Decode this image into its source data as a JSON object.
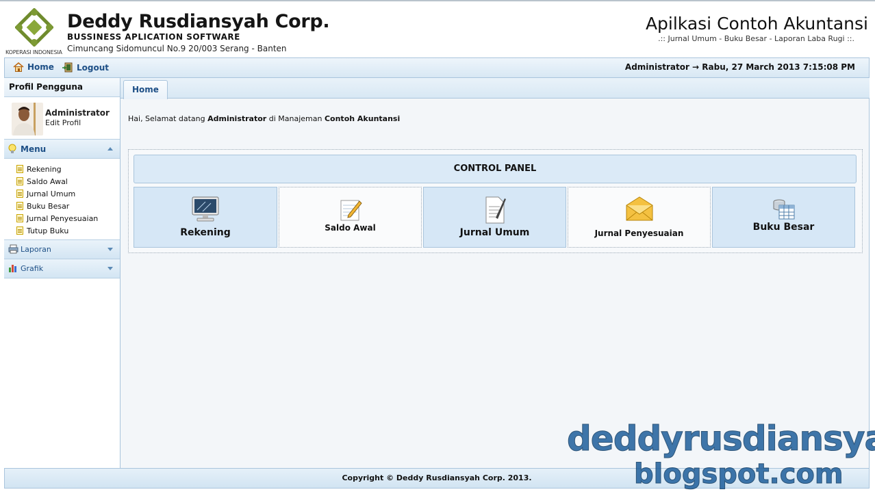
{
  "header": {
    "logo_caption": "KOPERASI INDONESIA",
    "company_name": "Deddy Rusdiansyah Corp.",
    "tagline": "BUSSINESS APLICATION SOFTWARE",
    "address": "Cimuncang Sidomuncul No.9 20/003 Serang - Banten",
    "app_title": "Apilkasi Contoh Akuntansi",
    "app_subtitle": ".:: Jurnal Umum - Buku Besar - Laporan Laba Rugi ::."
  },
  "topnav": {
    "home_label": "Home",
    "logout_label": "Logout",
    "status": "Administrator → Rabu, 27 March 2013 7:15:08 PM",
    "home_icon": "house-icon",
    "logout_icon": "logout-icon"
  },
  "sidebar": {
    "profile_header": "Profil Pengguna",
    "profile_name": "Administrator",
    "profile_edit": "Edit Profil",
    "menu_label": "Menu",
    "menu_items": [
      "Rekening",
      "Saldo Awal",
      "Jurnal Umum",
      "Buku Besar",
      "Jurnal Penyesuaian",
      "Tutup Buku"
    ],
    "laporan_label": "Laporan",
    "grafik_label": "Grafik"
  },
  "main": {
    "tab_label": "Home",
    "welcome_prefix": "Hai, Selamat datang ",
    "welcome_user": "Administrator",
    "welcome_middle": " di Manajeman ",
    "welcome_app": "Contoh Akuntansi",
    "control_panel_title": "CONTROL PANEL",
    "tiles": [
      {
        "label": "Rekening",
        "icon": "monitor-icon"
      },
      {
        "label": "Saldo Awal",
        "icon": "notepad-pencil-icon"
      },
      {
        "label": "Jurnal Umum",
        "icon": "document-pen-icon"
      },
      {
        "label": "Jurnal Penyesuaian",
        "icon": "envelope-icon"
      },
      {
        "label": "Buku Besar",
        "icon": "database-table-icon"
      }
    ]
  },
  "footer": {
    "copyright": "Copyright © Deddy Rusdiansyah Corp. 2013."
  },
  "watermark": {
    "line1": "deddyrusdiansyah",
    "line2": "blogspot.com"
  },
  "colors": {
    "accent": "#1d4f86",
    "panel_blue": "#d6e7f6",
    "border": "#a9c4dc"
  }
}
